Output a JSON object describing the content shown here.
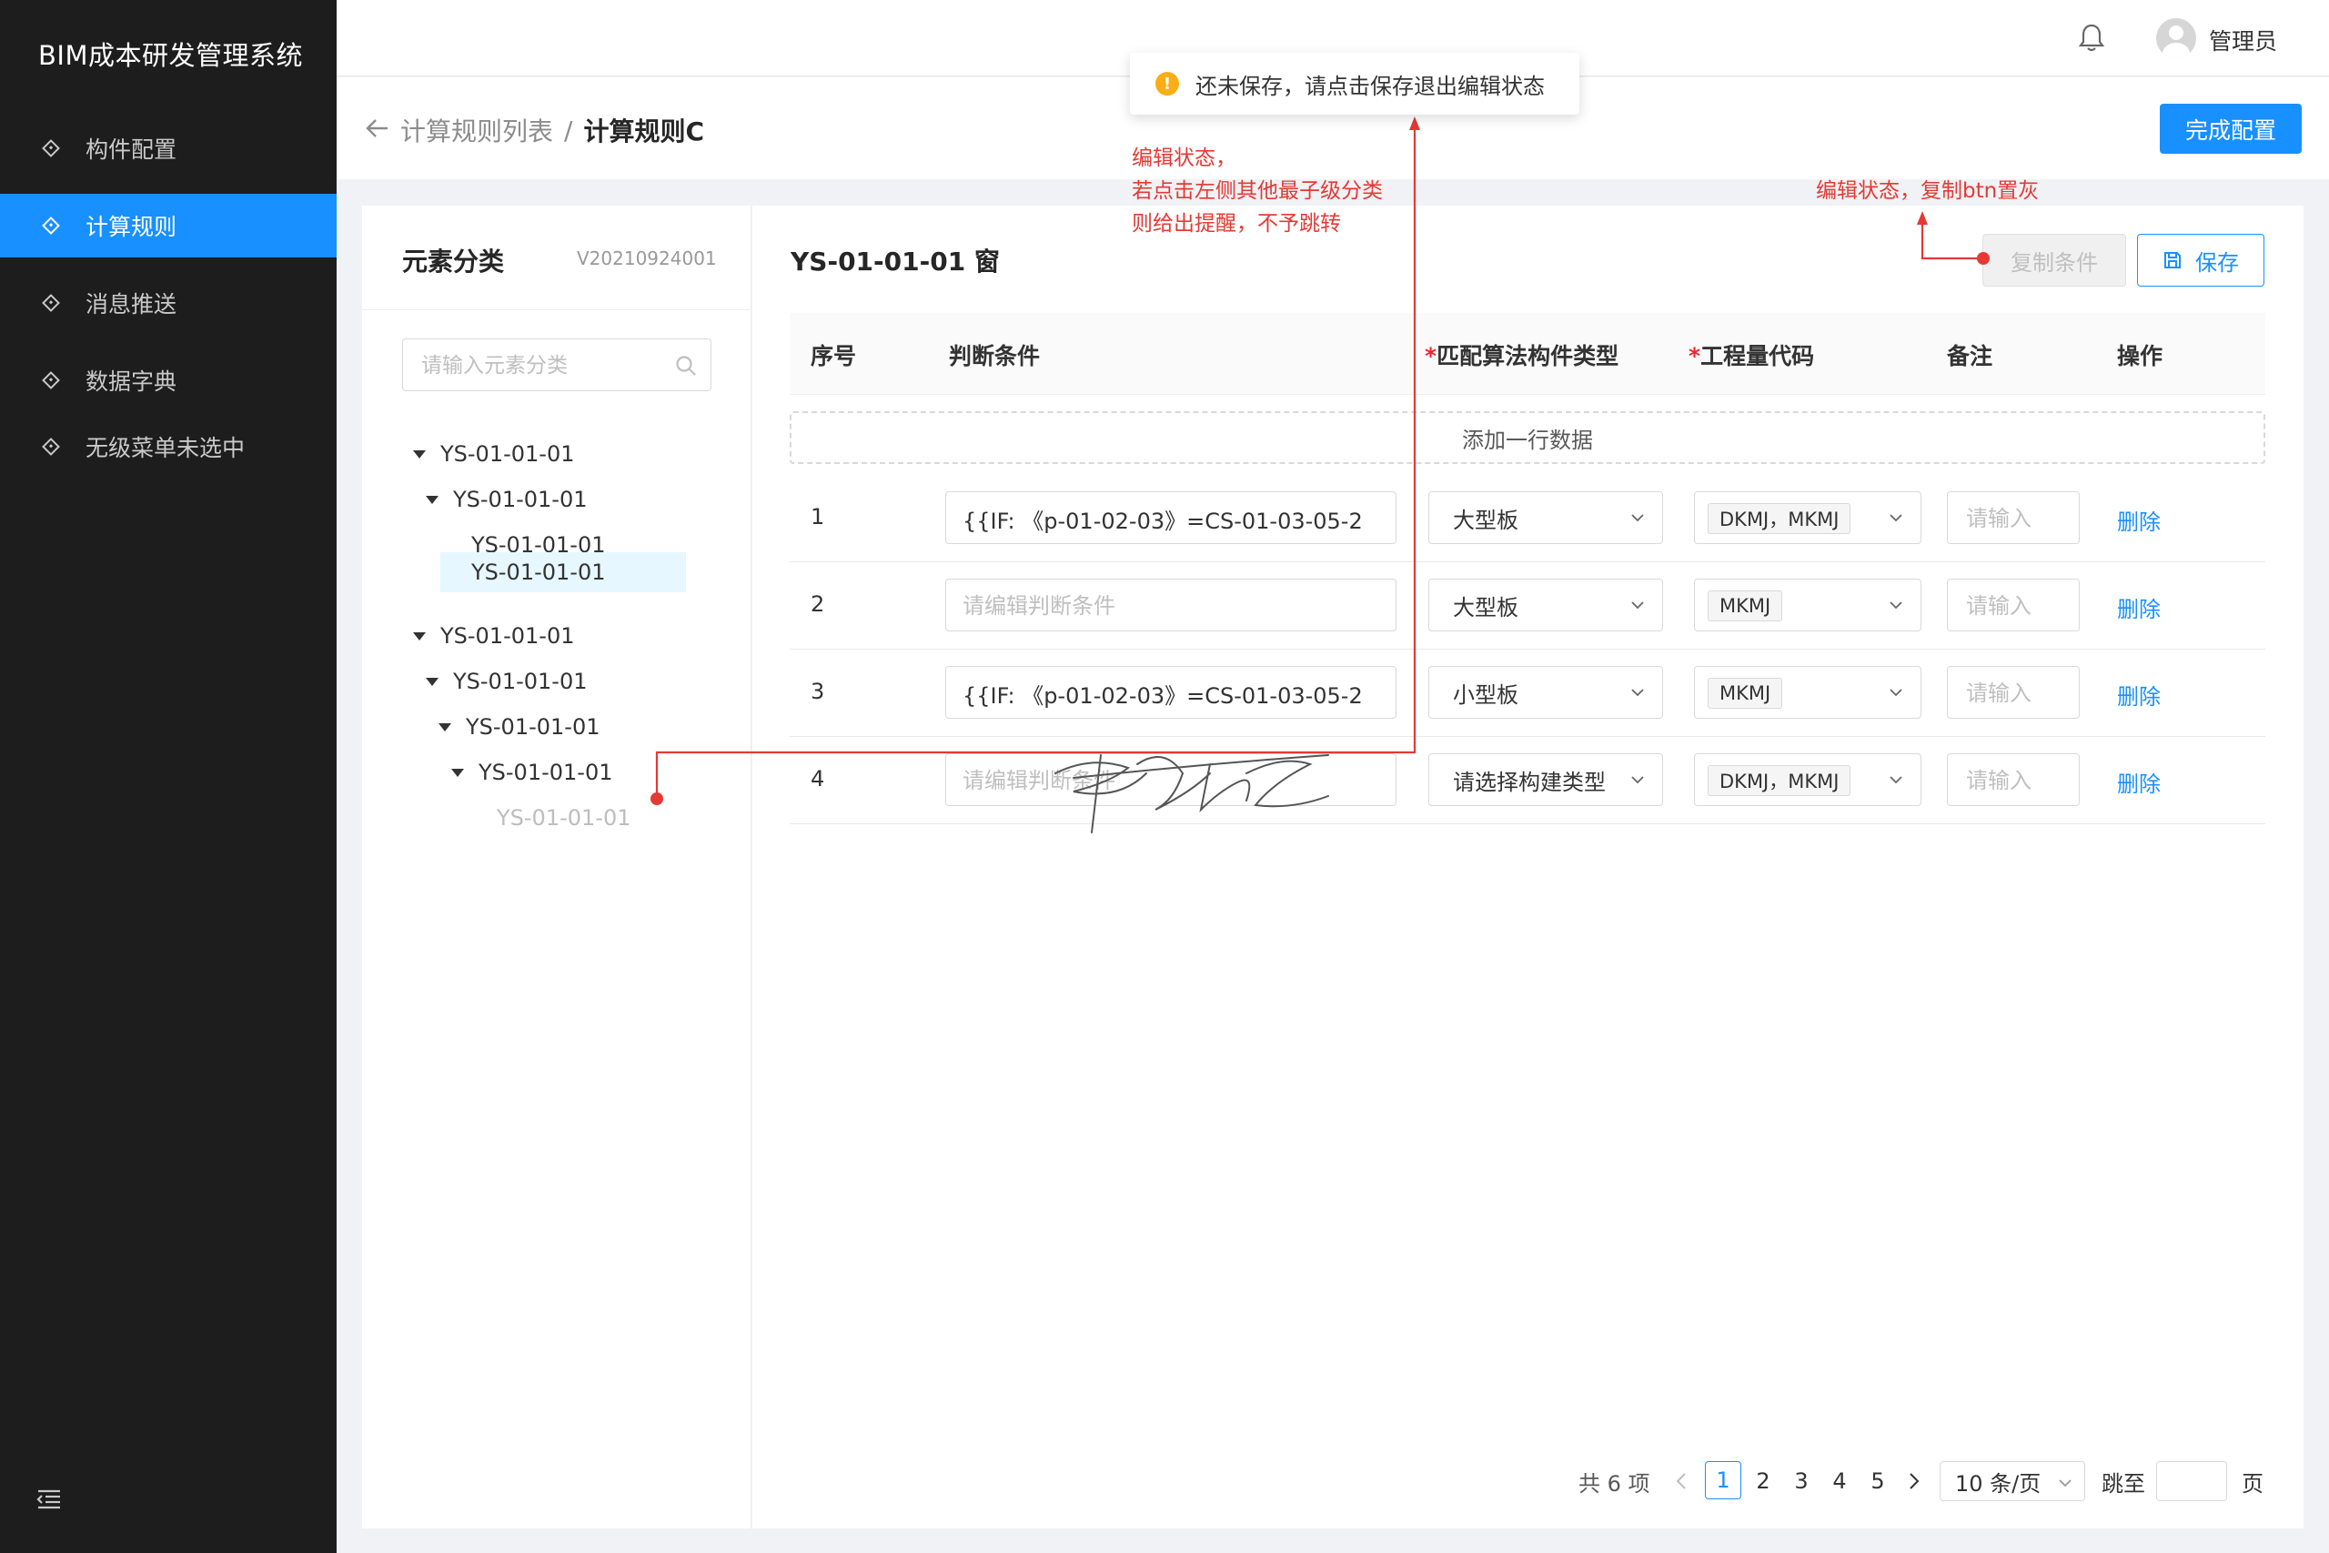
{
  "app": {
    "title": "BIM成本研发管理系统"
  },
  "sidebar": {
    "items": [
      {
        "label": "构件配置",
        "icon": "diamond-icon",
        "active": false
      },
      {
        "label": "计算规则",
        "icon": "diamond-icon",
        "active": true
      },
      {
        "label": "消息推送",
        "icon": "diamond-icon",
        "active": false
      },
      {
        "label": "数据字典",
        "icon": "diamond-icon",
        "active": false
      },
      {
        "label": "无级菜单未选中",
        "icon": "diamond-icon",
        "active": false
      }
    ],
    "collapse_icon": "menu-fold-icon"
  },
  "header": {
    "user_name": "管理员",
    "notification_icon": "bell-icon"
  },
  "breadcrumb": {
    "parent": "计算规则列表",
    "separator": "/",
    "current": "计算规则C"
  },
  "actions": {
    "finish_label": "完成配置",
    "copy_label": "复制条件",
    "save_label": "保存"
  },
  "toast": {
    "message": "还未保存，请点击保存退出编辑状态"
  },
  "annotations": {
    "left_note": [
      "编辑状态，",
      "若点击左侧其他最子级分类",
      "则给出提醒，不予跳转"
    ],
    "right_note": "编辑状态，复制btn置灰"
  },
  "category_panel": {
    "title": "元素分类",
    "version": "V20210924001",
    "search_placeholder": "请输入元素分类",
    "tree": [
      {
        "label": "YS-01-01-01",
        "level": 0,
        "expandable": true,
        "selected": false,
        "dim": false
      },
      {
        "label": "YS-01-01-01",
        "level": 1,
        "expandable": true,
        "selected": false,
        "dim": false
      },
      {
        "label": "YS-01-01-01",
        "level": 2,
        "expandable": false,
        "selected": false,
        "dim": false
      },
      {
        "label": "YS-01-01-01",
        "level": 2,
        "expandable": false,
        "selected": true,
        "dim": false
      },
      {
        "label": "YS-01-01-01",
        "level": 0,
        "expandable": true,
        "selected": false,
        "dim": false
      },
      {
        "label": "YS-01-01-01",
        "level": 1,
        "expandable": true,
        "selected": false,
        "dim": false
      },
      {
        "label": "YS-01-01-01",
        "level": 2,
        "expandable": true,
        "selected": false,
        "dim": false
      },
      {
        "label": "YS-01-01-01",
        "level": 3,
        "expandable": true,
        "selected": false,
        "dim": false
      },
      {
        "label": "YS-01-01-01",
        "level": 4,
        "expandable": false,
        "selected": false,
        "dim": true
      }
    ]
  },
  "rules": {
    "title": "YS-01-01-01 窗",
    "columns": {
      "seq": "序号",
      "condition": "判断条件",
      "required_mark": "*",
      "type": "匹配算法构件类型",
      "code": "工程量代码",
      "note": "备注",
      "action": "操作"
    },
    "add_row_label": "添加一行数据",
    "condition_placeholder": "请编辑判断条件",
    "note_placeholder": "请输入",
    "delete_label": "删除",
    "rows": [
      {
        "seq": "1",
        "condition": "{{IF: 《p-01-02-03》=CS-01-03-05-2",
        "type": "大型板",
        "code": "DKMJ，MKMJ"
      },
      {
        "seq": "2",
        "condition": "",
        "type": "大型板",
        "code": "MKMJ"
      },
      {
        "seq": "3",
        "condition": "{{IF: 《p-01-02-03》=CS-01-03-05-2",
        "type": "小型板",
        "code": "MKMJ"
      },
      {
        "seq": "4",
        "condition": "",
        "type": "请选择构建类型",
        "code": "DKMJ，MKMJ"
      }
    ]
  },
  "pagination": {
    "total_label": "共 6 项",
    "pages": [
      "1",
      "2",
      "3",
      "4",
      "5"
    ],
    "current_page": "1",
    "page_size_label": "10 条/页",
    "jump_label": "跳至",
    "page_suffix": "页",
    "prev_icon": "chevron-left-icon",
    "next_icon": "chevron-right-icon"
  },
  "colors": {
    "primary": "#1890ff",
    "sidebar_bg": "#1d1d1d",
    "annotation": "#e53935",
    "warning": "#faad14"
  }
}
